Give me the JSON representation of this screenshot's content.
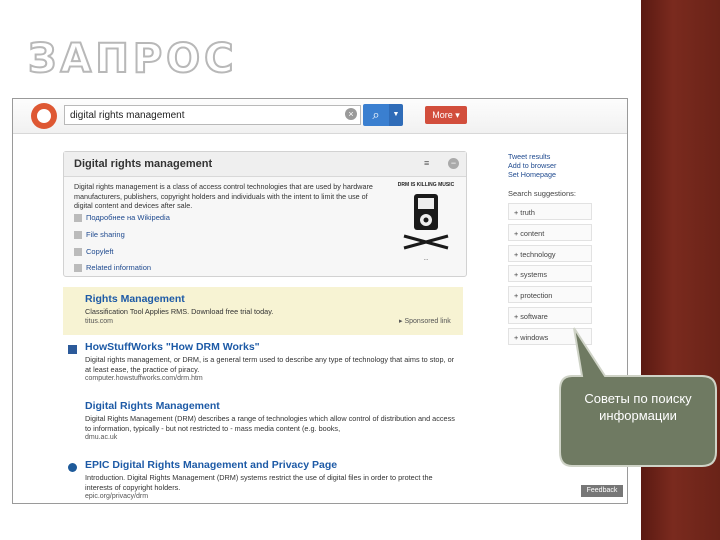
{
  "slide": {
    "title": "ЗАПРОС",
    "callout_text": "Советы по поиску информации"
  },
  "colors": {
    "accent_red": "#d24e3c",
    "link_blue": "#1d5aa6",
    "sponsored_bg": "#f7f3d3",
    "callout_fill": "#6f7a62",
    "side_band": "#6a2318"
  },
  "search": {
    "query": "digital rights management",
    "more_label": "More"
  },
  "zci": {
    "title": "Digital rights management",
    "description": "Digital rights management is a class of access control technologies that are used by hardware manufacturers, publishers, copyright holders and individuals with the intent to limit the use of digital content and devices after sale.",
    "links": [
      {
        "label": "Подробнее на Wikipedia",
        "icon": "wikipedia-icon"
      },
      {
        "label": "File sharing",
        "icon": "link-icon"
      },
      {
        "label": "Copyleft",
        "icon": "link-icon"
      },
      {
        "label": "Related information",
        "icon": "arrow-icon"
      }
    ],
    "image_caption": "DRM IS KILLING MUSIC"
  },
  "results": [
    {
      "title": "Rights Management",
      "snippet": "Classification Tool Applies RMS. Download free trial today.",
      "url": "titus.com",
      "label": "Sponsored link",
      "sponsored": true
    },
    {
      "title": "HowStuffWorks \"How DRM Works\"",
      "snippet": "Digital rights management, or DRM, is a general term used to describe any type of technology that aims to stop, or at least ease, the practice of piracy.",
      "url": "computer.howstuffworks.com/drm.htm",
      "sponsored": false
    },
    {
      "title": "Digital Rights Management",
      "snippet": "Digital Rights Management (DRM) describes a range of technologies which allow control of distribution and access to information, typically - but not restricted to - mass media content (e.g. books,",
      "url": "dmu.ac.uk",
      "sponsored": false
    },
    {
      "title": "EPIC Digital Rights Management and Privacy Page",
      "snippet": "Introduction. Digital Rights Management (DRM) systems restrict the use of digital files in order to protect the interests of copyright holders.",
      "url": "epic.org/privacy/drm",
      "sponsored": false
    }
  ],
  "sidebar": {
    "links": [
      "Tweet results",
      "Add to browser",
      "Set Homepage"
    ],
    "suggestions_heading": "Search suggestions:",
    "suggestions": [
      "+ truth",
      "+ content",
      "+ technology",
      "+ systems",
      "+ protection",
      "+ software",
      "+ windows"
    ]
  },
  "feedback_label": "Feedback"
}
